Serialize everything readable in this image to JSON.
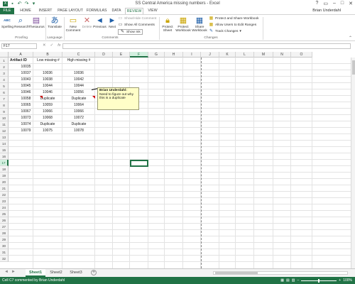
{
  "window": {
    "title": "SS Central America missing numbers - Excel",
    "user": "Brian Underdahl",
    "controls": [
      "?",
      "▭",
      "–",
      "□",
      "✕"
    ]
  },
  "tabs": [
    "FILE",
    "HOME",
    "INSERT",
    "PAGE LAYOUT",
    "FORMULAS",
    "DATA",
    "REVIEW",
    "VIEW"
  ],
  "ribbon": {
    "spelling": "Spelling",
    "research": "Research",
    "thesaurus": "Thesaurus",
    "translate": "Translate",
    "new_comment": "New Comment",
    "delete": "Delete",
    "previous": "Previous",
    "next": "Next",
    "show_hide_comment": "Show/Hide Comment",
    "show_all_comments": "Show All Comments",
    "show_ink": "Show Ink",
    "protect_sheet": "Protect Sheet",
    "protect_workbook": "Protect Workbook",
    "share_workbook": "Share Workbook",
    "protect_share": "Protect and Share Workbook",
    "allow_users": "Allow Users to Edit Ranges",
    "track_changes": "Track Changes",
    "groups": {
      "proofing": "Proofing",
      "language": "Language",
      "comments": "Comments",
      "changes": "Changes"
    },
    "abc_label": "ABC"
  },
  "formula_bar": {
    "name_box": "F17",
    "cancel": "✕",
    "enter": "✓",
    "fx": "fx",
    "value": ""
  },
  "columns": [
    "A",
    "B",
    "C",
    "D",
    "E",
    "F",
    "G",
    "H",
    "I",
    "J",
    "K",
    "L",
    "M",
    "N",
    "O"
  ],
  "selected_column": "F",
  "rows": [
    "1",
    "2",
    "3",
    "4",
    "5",
    "6",
    "7",
    "8",
    "9",
    "10",
    "11",
    "12",
    "13",
    "14",
    "15",
    "16",
    "17",
    "18",
    "19",
    "20",
    "21",
    "22",
    "23",
    "24",
    "25",
    "26",
    "27",
    "28",
    "29",
    "30",
    "31",
    "32"
  ],
  "selected_row": "17",
  "cells": {
    "a1": "Artifact ID",
    "b1": "Low missing #",
    "c1": "High missing #",
    "a2": "10035",
    "a3": "10037",
    "b3": "10036",
    "c3": "10036",
    "a4": "10043",
    "b4": "10038",
    "c4": "10042",
    "a5": "10045",
    "b5": "10044",
    "c5": "10044",
    "a6": "10046",
    "b6": "10046",
    "c6": "10056",
    "a7": "10058",
    "b7": "Duplicate",
    "c7": "Duplicate",
    "a8": "10065",
    "b8": "10059",
    "c8": "10064",
    "a9": "10067",
    "b9": "10066",
    "c9": "10066",
    "a10": "10073",
    "b10": "10068",
    "c10": "10072",
    "a11": "10074",
    "b11": "Duplicate",
    "c11": "Duplicate",
    "a12": "10079",
    "b12": "10075",
    "c12": "10078"
  },
  "comment": {
    "author": "Brian Underdahl:",
    "text": "Need to figure out why this is a duplicate"
  },
  "sheets": [
    "Sheet1",
    "Sheet2",
    "Sheet3"
  ],
  "status": {
    "text": "Cell C7 commented by Brian Underdahl",
    "zoom": "100%"
  },
  "colors": {
    "accent": "#217346",
    "comment_bg": "#fffec8",
    "comment_marker": "#cc0000"
  }
}
